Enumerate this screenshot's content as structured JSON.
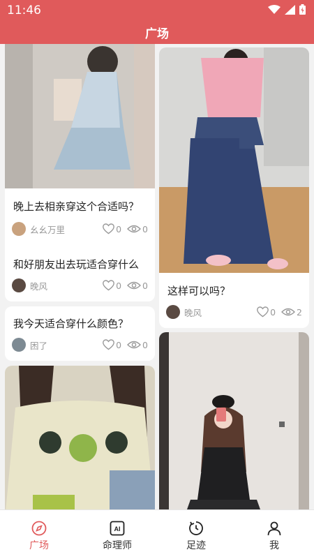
{
  "status_bar": {
    "time": "11:46"
  },
  "header": {
    "title": "广场"
  },
  "posts": [
    {
      "text": "晚上去相亲穿这个合适吗？",
      "author": "幺幺万里",
      "likes": "0",
      "views": "0"
    },
    {
      "text": "和好朋友出去玩适合穿什么",
      "author": "晚风",
      "likes": "0",
      "views": "0"
    },
    {
      "text": "我今天适合穿什么颜色？",
      "author": "困了",
      "likes": "0",
      "views": "0"
    },
    {
      "text": "这样可以吗？",
      "author": "晚风",
      "likes": "0",
      "views": "2"
    }
  ],
  "tabs": [
    {
      "label": "广场",
      "icon": "compass-icon",
      "active": true
    },
    {
      "label": "命理师",
      "icon": "ai-icon",
      "active": false
    },
    {
      "label": "足迹",
      "icon": "history-icon",
      "active": false
    },
    {
      "label": "我",
      "icon": "user-icon",
      "active": false
    }
  ],
  "colors": {
    "accent": "#e05a5b",
    "muted": "#999999"
  }
}
